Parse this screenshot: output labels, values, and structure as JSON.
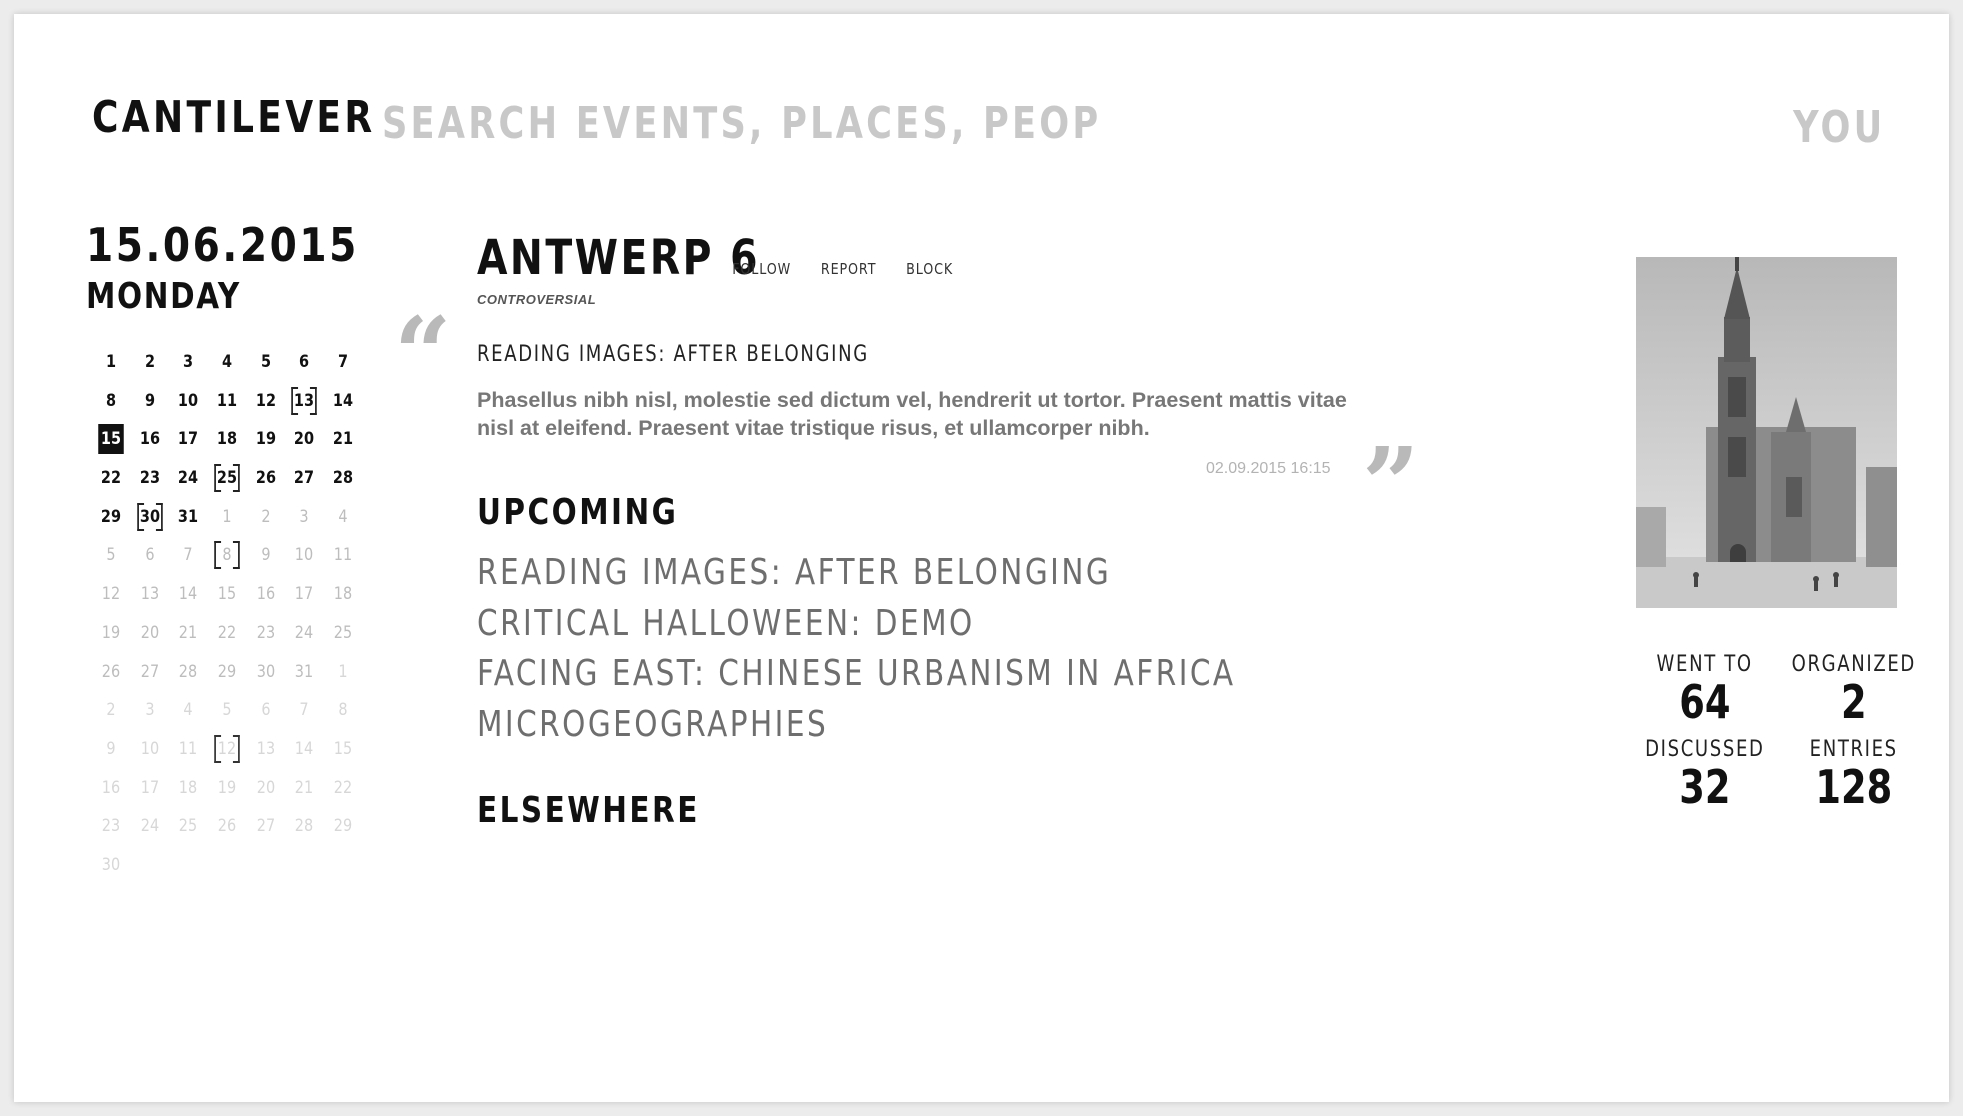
{
  "header": {
    "logo": "CANTILEVER",
    "search_placeholder": "SEARCH EVENTS, PLACES, PEOPLE...",
    "user_menu": "YOU"
  },
  "calendar": {
    "date": "15.06.2015",
    "weekday": "MONDAY",
    "days": [
      {
        "n": "1",
        "s": "cur"
      },
      {
        "n": "2",
        "s": "cur"
      },
      {
        "n": "3",
        "s": "cur"
      },
      {
        "n": "4",
        "s": "cur"
      },
      {
        "n": "5",
        "s": "cur"
      },
      {
        "n": "6",
        "s": "cur"
      },
      {
        "n": "7",
        "s": "cur"
      },
      {
        "n": "8",
        "s": "cur"
      },
      {
        "n": "9",
        "s": "cur"
      },
      {
        "n": "10",
        "s": "cur"
      },
      {
        "n": "11",
        "s": "cur"
      },
      {
        "n": "12",
        "s": "cur"
      },
      {
        "n": "13",
        "s": "cur",
        "event": true
      },
      {
        "n": "14",
        "s": "cur"
      },
      {
        "n": "15",
        "s": "sel"
      },
      {
        "n": "16",
        "s": "cur"
      },
      {
        "n": "17",
        "s": "cur"
      },
      {
        "n": "18",
        "s": "cur"
      },
      {
        "n": "19",
        "s": "cur"
      },
      {
        "n": "20",
        "s": "cur"
      },
      {
        "n": "21",
        "s": "cur"
      },
      {
        "n": "22",
        "s": "cur"
      },
      {
        "n": "23",
        "s": "cur"
      },
      {
        "n": "24",
        "s": "cur"
      },
      {
        "n": "25",
        "s": "cur",
        "event": true
      },
      {
        "n": "26",
        "s": "cur"
      },
      {
        "n": "27",
        "s": "cur"
      },
      {
        "n": "28",
        "s": "cur"
      },
      {
        "n": "29",
        "s": "cur"
      },
      {
        "n": "30",
        "s": "cur",
        "event": true
      },
      {
        "n": "31",
        "s": "cur"
      },
      {
        "n": "1",
        "s": "near"
      },
      {
        "n": "2",
        "s": "near"
      },
      {
        "n": "3",
        "s": "near"
      },
      {
        "n": "4",
        "s": "near"
      },
      {
        "n": "5",
        "s": "near"
      },
      {
        "n": "6",
        "s": "near"
      },
      {
        "n": "7",
        "s": "near"
      },
      {
        "n": "8",
        "s": "near",
        "event": true
      },
      {
        "n": "9",
        "s": "near"
      },
      {
        "n": "10",
        "s": "near"
      },
      {
        "n": "11",
        "s": "near"
      },
      {
        "n": "12",
        "s": "near"
      },
      {
        "n": "13",
        "s": "near"
      },
      {
        "n": "14",
        "s": "near"
      },
      {
        "n": "15",
        "s": "near"
      },
      {
        "n": "16",
        "s": "near"
      },
      {
        "n": "17",
        "s": "near"
      },
      {
        "n": "18",
        "s": "near"
      },
      {
        "n": "19",
        "s": "near"
      },
      {
        "n": "20",
        "s": "near"
      },
      {
        "n": "21",
        "s": "near"
      },
      {
        "n": "22",
        "s": "near"
      },
      {
        "n": "23",
        "s": "near"
      },
      {
        "n": "24",
        "s": "near"
      },
      {
        "n": "25",
        "s": "near"
      },
      {
        "n": "26",
        "s": "near"
      },
      {
        "n": "27",
        "s": "near"
      },
      {
        "n": "28",
        "s": "near"
      },
      {
        "n": "29",
        "s": "near"
      },
      {
        "n": "30",
        "s": "near"
      },
      {
        "n": "31",
        "s": "near"
      },
      {
        "n": "1",
        "s": "far"
      },
      {
        "n": "2",
        "s": "far"
      },
      {
        "n": "3",
        "s": "far"
      },
      {
        "n": "4",
        "s": "far"
      },
      {
        "n": "5",
        "s": "far"
      },
      {
        "n": "6",
        "s": "far"
      },
      {
        "n": "7",
        "s": "far"
      },
      {
        "n": "8",
        "s": "far"
      },
      {
        "n": "9",
        "s": "far"
      },
      {
        "n": "10",
        "s": "far"
      },
      {
        "n": "11",
        "s": "far"
      },
      {
        "n": "12",
        "s": "far",
        "event": true
      },
      {
        "n": "13",
        "s": "far"
      },
      {
        "n": "14",
        "s": "far"
      },
      {
        "n": "15",
        "s": "far"
      },
      {
        "n": "16",
        "s": "far"
      },
      {
        "n": "17",
        "s": "far"
      },
      {
        "n": "18",
        "s": "far"
      },
      {
        "n": "19",
        "s": "far"
      },
      {
        "n": "20",
        "s": "far"
      },
      {
        "n": "21",
        "s": "far"
      },
      {
        "n": "22",
        "s": "far"
      },
      {
        "n": "23",
        "s": "far"
      },
      {
        "n": "24",
        "s": "far"
      },
      {
        "n": "25",
        "s": "far"
      },
      {
        "n": "26",
        "s": "far"
      },
      {
        "n": "27",
        "s": "far"
      },
      {
        "n": "28",
        "s": "far"
      },
      {
        "n": "29",
        "s": "far"
      },
      {
        "n": "30",
        "s": "far"
      }
    ]
  },
  "place": {
    "title": "ANTWERP 6",
    "actions": {
      "follow": "FOLLOW",
      "report": "REPORT",
      "block": "BLOCK"
    },
    "tag": "CONTROVERSIAL"
  },
  "entry": {
    "title": "READING IMAGES: AFTER BELONGING",
    "body": "Phasellus nibh nisl, molestie sed dictum vel, hendrerit ut tortor. Praesent mattis vitae nisl at eleifend. Praesent vitae tristique risus, et ullamcorper nibh.",
    "timestamp": "02.09.2015 16:15"
  },
  "upcoming": {
    "heading": "UPCOMING",
    "items": [
      "READING IMAGES: AFTER BELONGING",
      "CRITICAL HALLOWEEN: DEMO",
      "FACING EAST: CHINESE URBANISM IN AFRICA",
      "MICROGEOGRAPHIES"
    ]
  },
  "elsewhere": {
    "heading": "ELSEWHERE"
  },
  "stats": {
    "went_to_label": "WENT TO",
    "went_to": "64",
    "organized_label": "ORGANIZED",
    "organized": "2",
    "discussed_label": "DISCUSSED",
    "discussed": "32",
    "entries_label": "ENTRIES",
    "entries": "128"
  }
}
